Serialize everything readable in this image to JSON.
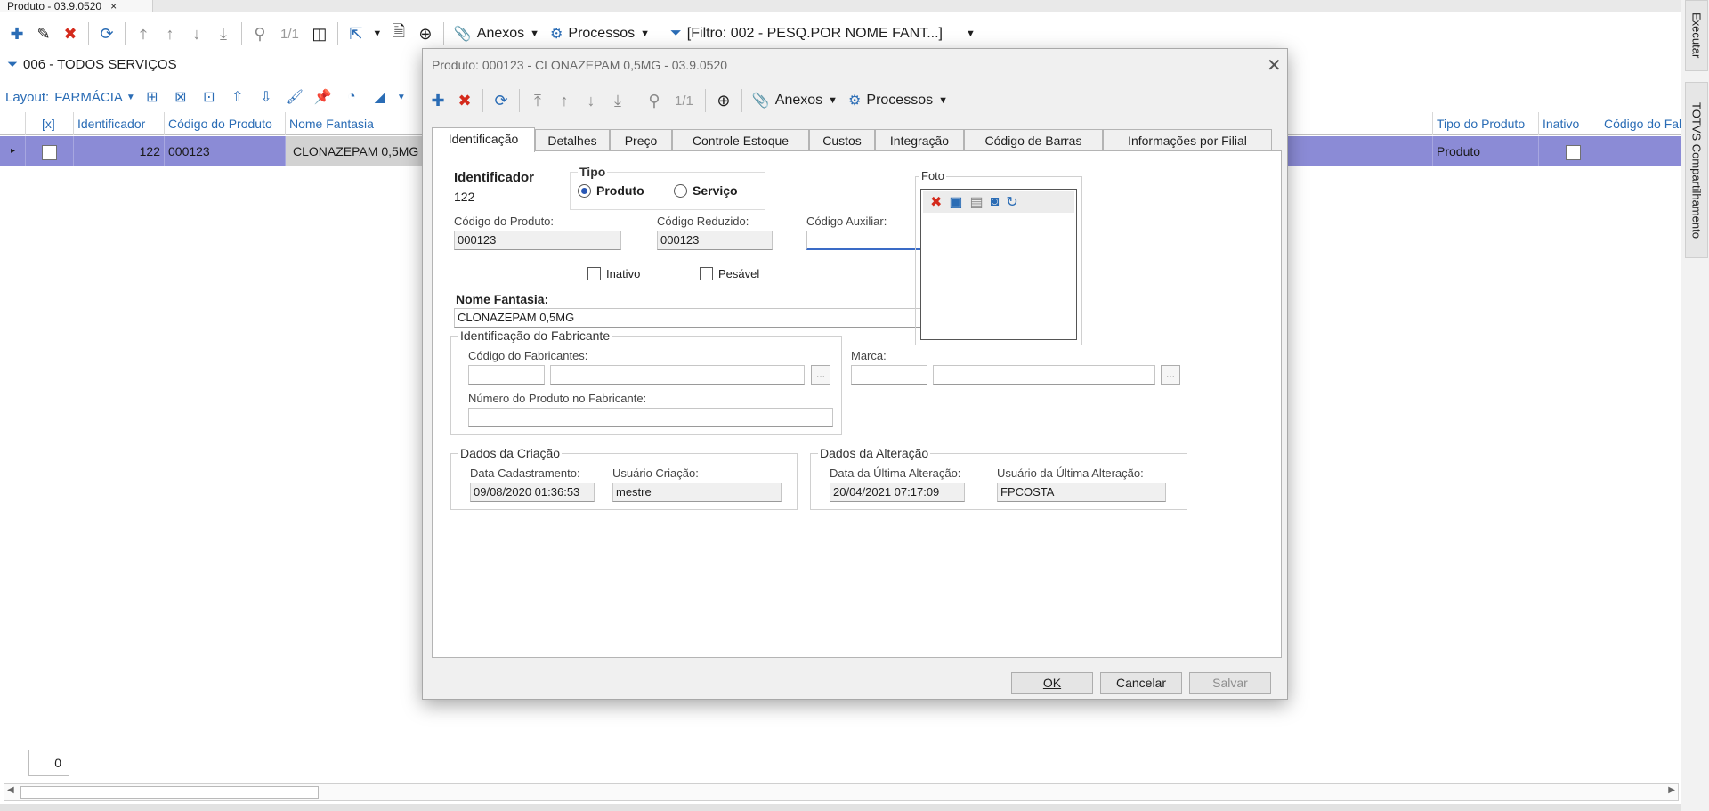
{
  "window": {
    "doc_tab_label": "Produto - 03.9.0520",
    "doc_tab_close": "×"
  },
  "main_toolbar": {
    "pager": "1/1",
    "anexos": "Anexos",
    "processos": "Processos",
    "filtro": "[Filtro: 002 - PESQ.POR NOME FANT...]"
  },
  "filter_title": "006 - TODOS SERVIÇOS",
  "layout": {
    "label": "Layout:",
    "value": "FARMÁCIA"
  },
  "grid": {
    "headers": {
      "select": "[x]",
      "identificador": "Identificador",
      "codigo_produto": "Código do Produto",
      "nome_fantasia": "Nome Fantasia",
      "tipo_produto": "Tipo do Produto",
      "inativo": "Inativo",
      "codigo_fab": "Código do Fab"
    },
    "row": {
      "identificador": "122",
      "codigo_produto": "000123",
      "nome_fantasia": "CLONAZEPAM 0,5MG",
      "tipo_produto": "Produto"
    }
  },
  "counter": "0",
  "side_panel": {
    "executar": "Executar",
    "compartilhamento": "TOTVS Compartilhamento"
  },
  "dialog": {
    "title": "Produto: 000123 - CLONAZEPAM 0,5MG - 03.9.0520",
    "close": "✕",
    "toolbar": {
      "pager": "1/1",
      "anexos": "Anexos",
      "processos": "Processos"
    },
    "tabs": [
      "Identificação",
      "Detalhes",
      "Preço",
      "Controle Estoque",
      "Custos",
      "Integração",
      "Código de Barras",
      "Informações por Filial"
    ],
    "form": {
      "identificador_label": "Identificador",
      "identificador_value": "122",
      "tipo_label": "Tipo",
      "tipo_produto": "Produto",
      "tipo_servico": "Serviço",
      "codigo_produto_label": "Código do Produto:",
      "codigo_produto_value": "000123",
      "codigo_reduzido_label": "Código Reduzido:",
      "codigo_reduzido_value": "000123",
      "codigo_auxiliar_label": "Código Auxiliar:",
      "codigo_auxiliar_value": "",
      "inativo_label": "Inativo",
      "pesavel_label": "Pesável",
      "nome_fantasia_label": "Nome Fantasia:",
      "nome_fantasia_value": "CLONAZEPAM 0,5MG",
      "foto_label": "Foto",
      "fabricante_group": "Identificação do Fabricante",
      "codigo_fabricantes_label": "Código do Fabricantes:",
      "marca_label": "Marca:",
      "numero_produto_fab_label": "Número do Produto no Fabricante:",
      "ellipsis": "...",
      "criacao_group": "Dados da Criação",
      "data_cadastramento_label": "Data Cadastramento:",
      "data_cadastramento_value": "09/08/2020 01:36:53",
      "usuario_criacao_label": "Usuário Criação:",
      "usuario_criacao_value": "mestre",
      "alteracao_group": "Dados da Alteração",
      "data_ultima_alteracao_label": "Data da Última Alteração:",
      "data_ultima_alteracao_value": "20/04/2021 07:17:09",
      "usuario_ultima_alteracao_label": "Usuário da Última Alteração:",
      "usuario_ultima_alteracao_value": "FPCOSTA"
    },
    "buttons": {
      "ok": "OK",
      "cancelar": "Cancelar",
      "salvar": "Salvar"
    }
  }
}
